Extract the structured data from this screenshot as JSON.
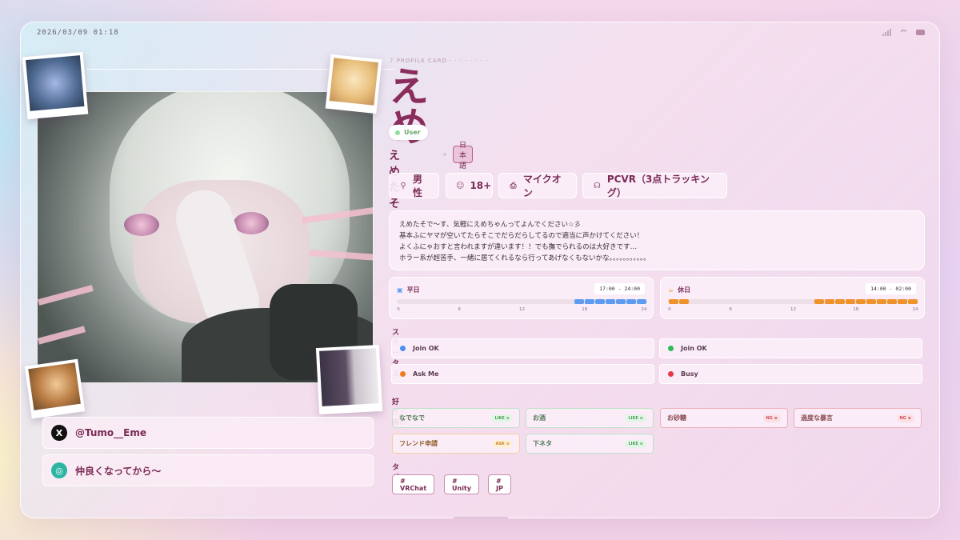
{
  "header": {
    "datetime": "2026/03/09 01:18"
  },
  "profile": {
    "section_label": "PROFILE CARD",
    "display_name": "えめ",
    "role_badge": "User",
    "handle_name": "えめたそ",
    "language": "日本語"
  },
  "chips": [
    {
      "icon": "person-icon",
      "label": "男性"
    },
    {
      "icon": "age-icon",
      "label": "18+"
    },
    {
      "icon": "mic-icon",
      "label": "マイクオン"
    },
    {
      "icon": "headset-icon",
      "label": "PCVR（3点トラッキング）"
    }
  ],
  "bio": [
    "えめたそで〜す、気軽にえめちゃんってよんでください☆彡",
    "基本ふにヤマが空いてたらそこでだらだらしてるので適当に声かけてください！",
    "よくふにゃおすと言われますが違います！！でも撫でられるのは大好きです…",
    "ホラー系が超苦手、一緒に居てくれるなら行ってあげなくもないかな。。。。。。。。。。。"
  ],
  "schedule": {
    "weekday": {
      "label": "平日",
      "time": "17:00 - 24:00",
      "color": "#5b9cf0",
      "ranges": [
        [
          17,
          24
        ]
      ],
      "ticks": [
        "0",
        "6",
        "12",
        "18",
        "24"
      ]
    },
    "holiday": {
      "label": "休日",
      "time": "14:00 - 02:00",
      "color": "#f0922a",
      "ranges": [
        [
          0,
          2
        ],
        [
          14,
          24
        ]
      ],
      "ticks": [
        "0",
        "6",
        "12",
        "18",
        "24"
      ]
    }
  },
  "status": {
    "title": "ステータス",
    "items": [
      {
        "label": "Join OK",
        "color": "#4a8ff0"
      },
      {
        "label": "Join OK",
        "color": "#2dbb59"
      },
      {
        "label": "Ask Me",
        "color": "#f07a1e"
      },
      {
        "label": "Busy",
        "color": "#e8394a"
      }
    ]
  },
  "preferences": {
    "title": "好き・嫌い",
    "items": [
      {
        "label": "なでなで",
        "type": "like",
        "badge": "LIKE"
      },
      {
        "label": "お酒",
        "type": "like",
        "badge": "LIKE"
      },
      {
        "label": "お砂糖",
        "type": "ng",
        "badge": "NG"
      },
      {
        "label": "過度な暴言",
        "type": "ng",
        "badge": "NG"
      },
      {
        "label": "フレンド申請",
        "type": "ask",
        "badge": "ASK"
      },
      {
        "label": "下ネタ",
        "type": "like",
        "badge": "LIKE"
      }
    ]
  },
  "tags": {
    "title": "タグ",
    "items": [
      "# VRChat",
      "# Unity",
      "# JP"
    ]
  },
  "social": {
    "x_handle": "@Tumo__Eme",
    "discord_note": "仲良くなってから〜"
  }
}
